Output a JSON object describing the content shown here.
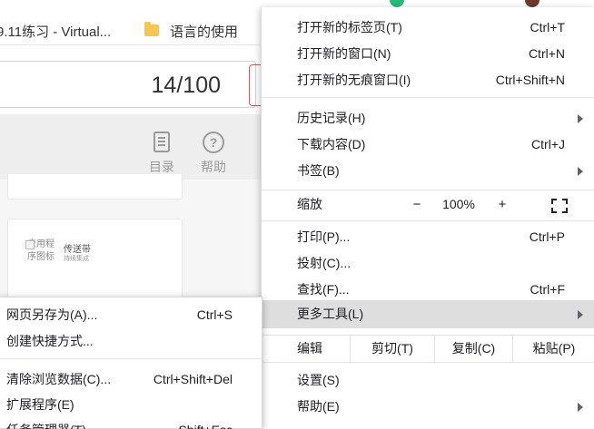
{
  "bookmarks": {
    "tab_fragment": "9.11练习 - Virtual...",
    "folder_label": "语言的使用"
  },
  "page": {
    "counter": "14/100",
    "toolbar": [
      {
        "label": "目录",
        "icon": "document-list-icon"
      },
      {
        "label": "帮助",
        "icon": "question-circle-icon"
      }
    ],
    "app_card": {
      "image_alt": "应用程序图标",
      "title": "传送带",
      "subtitle": "持续集成"
    }
  },
  "menu": {
    "new_tab": {
      "label": "打开新的标签页(T)",
      "shortcut": "Ctrl+T"
    },
    "new_window": {
      "label": "打开新的窗口(N)",
      "shortcut": "Ctrl+N"
    },
    "incognito": {
      "label": "打开新的无痕窗口(I)",
      "shortcut": "Ctrl+Shift+N"
    },
    "history": {
      "label": "历史记录(H)"
    },
    "downloads": {
      "label": "下载内容(D)",
      "shortcut": "Ctrl+J"
    },
    "bookmarks": {
      "label": "书签(B)"
    },
    "zoom": {
      "label": "缩放",
      "minus": "−",
      "value": "100%",
      "plus": "+"
    },
    "print": {
      "label": "打印(P)...",
      "shortcut": "Ctrl+P"
    },
    "cast": {
      "label": "投射(C)..."
    },
    "find": {
      "label": "查找(F)...",
      "shortcut": "Ctrl+F"
    },
    "more_tools": {
      "label": "更多工具(L)"
    },
    "edit": {
      "label": "编辑",
      "cut": "剪切(T)",
      "copy": "复制(C)",
      "paste": "粘贴(P)"
    },
    "settings": {
      "label": "设置(S)"
    },
    "help": {
      "label": "帮助(E)"
    }
  },
  "submenu": {
    "save_page": {
      "label": "网页另存为(A)...",
      "shortcut": "Ctrl+S"
    },
    "create_shortcut": {
      "label": "创建快捷方式..."
    },
    "clear_data": {
      "label": "清除浏览数据(C)...",
      "shortcut": "Ctrl+Shift+Del"
    },
    "extensions": {
      "label": "扩展程序(E)"
    },
    "task_manager": {
      "label": "任务管理器(T)",
      "shortcut": "Shift+Esc"
    }
  },
  "colors": {
    "highlight": "#dedede",
    "counter_border": "#d95454",
    "folder": "#f5c84d"
  }
}
